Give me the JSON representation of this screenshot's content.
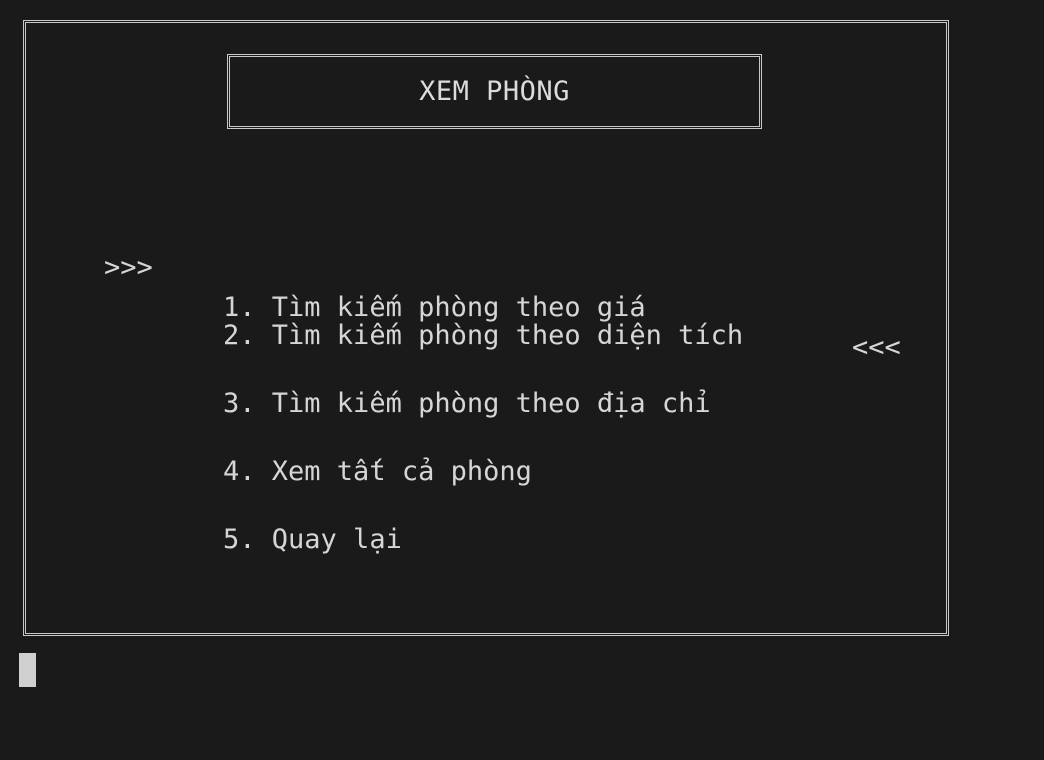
{
  "title": "XEM PHÒNG",
  "selection": {
    "left_marker": ">>>",
    "right_marker": "<<<"
  },
  "menu": {
    "items": [
      {
        "number": "1.",
        "label": "Tìm kiếm phòng theo giá"
      },
      {
        "number": "2.",
        "label": "Tìm kiếm phòng theo diện tích"
      },
      {
        "number": "3.",
        "label": "Tìm kiếm phòng theo địa chỉ"
      },
      {
        "number": "4.",
        "label": "Xem tất cả phòng"
      },
      {
        "number": "5.",
        "label": "Quay lại"
      }
    ]
  },
  "colors": {
    "background": "#1a1a1a",
    "text": "#d6d6d6",
    "border": "#c8c8c8",
    "cursor": "#d0d0d0"
  }
}
